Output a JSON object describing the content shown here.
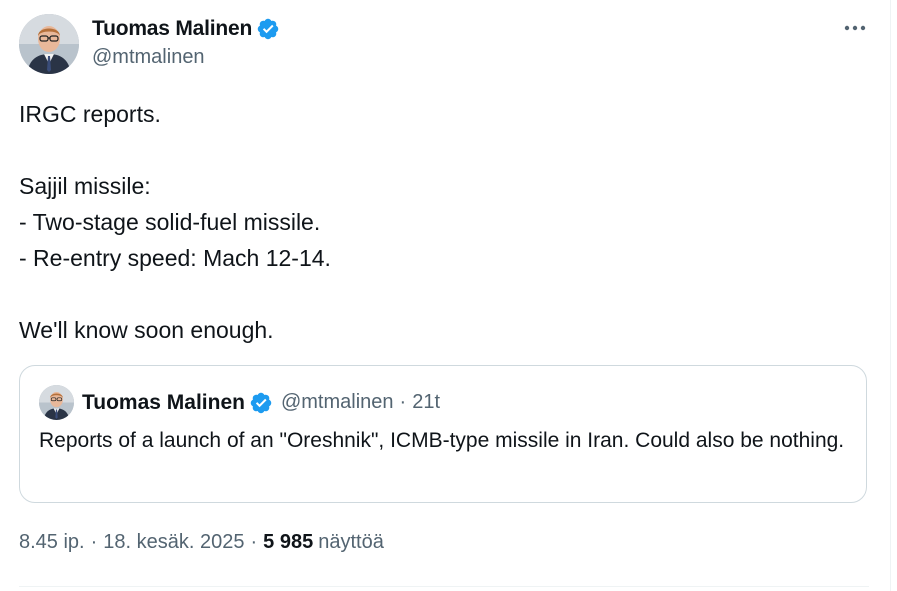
{
  "author": {
    "display_name": "Tuomas Malinen",
    "handle": "@mtmalinen",
    "verified_icon": "verified-badge-icon",
    "avatar_icon": "avatar-portrait"
  },
  "menu": {
    "icon": "more-horizontal-icon"
  },
  "tweet": {
    "text": "IRGC reports.\n\nSajjil missile:\n- Two-stage solid-fuel missile.\n- Re-entry speed: Mach 12-14.\n\nWe'll know soon enough."
  },
  "quote": {
    "display_name": "Tuomas Malinen",
    "handle": "@mtmalinen",
    "separator": "·",
    "time": "21t",
    "text": "Reports of a launch of an \"Oreshnik\", ICMB-type missile in Iran. Could also be nothing."
  },
  "meta": {
    "time": "8.45 ip.",
    "separator": "·",
    "date": "18. kesäk. 2025",
    "views_count": "5 985",
    "views_label": "näyttöä"
  },
  "colors": {
    "text_primary": "#0f1419",
    "text_secondary": "#536471",
    "verified_blue": "#1d9bf0",
    "border": "#cfd9de"
  }
}
